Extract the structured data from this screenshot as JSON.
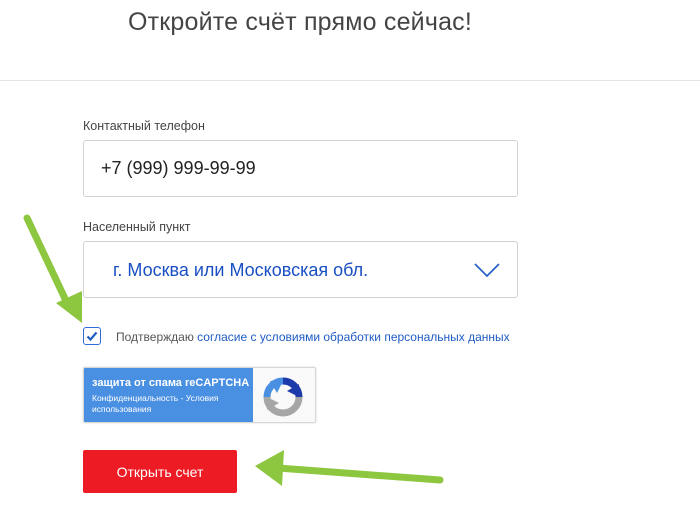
{
  "header": {
    "title": "Откройте счёт прямо сейчас!"
  },
  "form": {
    "phone": {
      "label": "Контактный телефон",
      "value": "+7 (999) 999-99-99"
    },
    "city": {
      "label": "Населенный пункт",
      "selected": "г. Москва или Московская обл.",
      "icon": "chevron-down-icon"
    },
    "consent": {
      "checked": true,
      "text": "Подтверждаю ",
      "link": "согласие с условиями обработки персональных данных"
    },
    "recaptcha": {
      "title": "защита от спама reCAPTCHA",
      "privacy": "Конфиденциальность",
      "separator": " - ",
      "terms": "Условия использования"
    },
    "submit_label": "Открыть счет"
  },
  "colors": {
    "accent_red": "#ed1c24",
    "link_blue": "#1f5bc4",
    "annotation_arrow": "#8dc63f"
  }
}
